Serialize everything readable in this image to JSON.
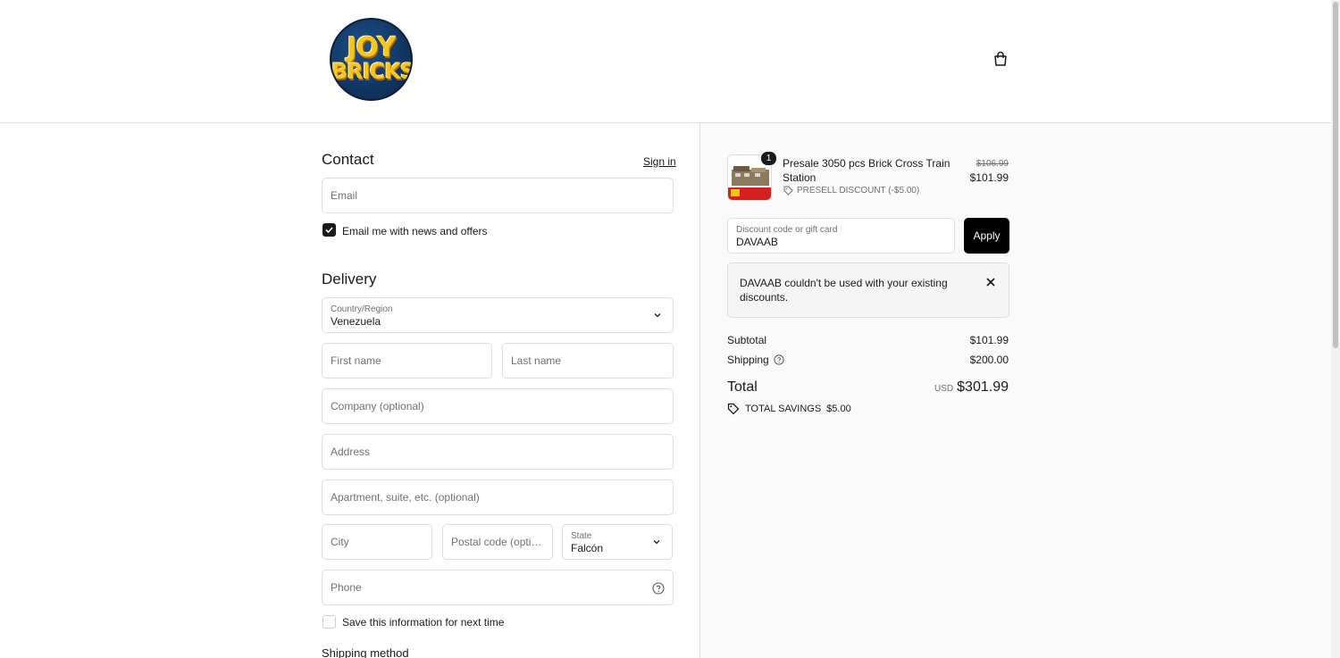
{
  "header": {
    "logo_line1": "JOY",
    "logo_line2": "BRICKS",
    "cart_icon": "shopping-bag-icon"
  },
  "contact": {
    "title": "Contact",
    "sign_in": "Sign in",
    "email_placeholder": "Email",
    "news_label": "Email me with news and offers",
    "news_checked": true
  },
  "delivery": {
    "title": "Delivery",
    "country_label": "Country/Region",
    "country_value": "Venezuela",
    "first_name": "First name",
    "last_name": "Last name",
    "company": "Company (optional)",
    "address": "Address",
    "apartment": "Apartment, suite, etc. (optional)",
    "city": "City",
    "postal": "Postal code (optional)",
    "state_label": "State",
    "state_value": "Falcón",
    "phone": "Phone",
    "save_label": "Save this information for next time",
    "save_checked": false
  },
  "shipping_method": {
    "title": "Shipping method"
  },
  "summary": {
    "item": {
      "quantity": "1",
      "name": "Presale 3050 pcs Brick Cross Train Station",
      "discount": "PRESELL DISCOUNT (-$5.00)",
      "original_price": "$106.99",
      "price": "$101.99"
    },
    "discount_label": "Discount code or gift card",
    "discount_value": "DAVAAB",
    "apply": "Apply",
    "error": "DAVAAB couldn't be used with your existing discounts.",
    "subtotal_label": "Subtotal",
    "subtotal": "$101.99",
    "shipping_label": "Shipping",
    "shipping": "$200.00",
    "total_label": "Total",
    "currency": "USD",
    "total": "$301.99",
    "savings_label": "TOTAL SAVINGS",
    "savings": "$5.00"
  }
}
